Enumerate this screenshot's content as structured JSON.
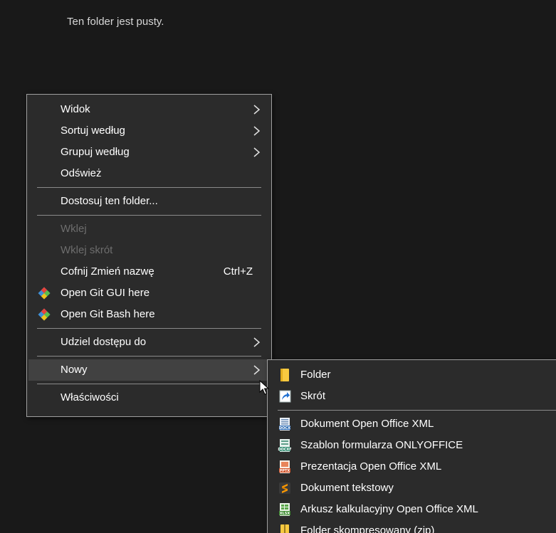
{
  "explorer": {
    "empty_message": "Ten folder jest pusty."
  },
  "context_menu": {
    "items": [
      {
        "label": "Widok"
      },
      {
        "label": "Sortuj według"
      },
      {
        "label": "Grupuj według"
      },
      {
        "label": "Odśwież"
      },
      {
        "label": "Dostosuj ten folder..."
      },
      {
        "label": "Wklej"
      },
      {
        "label": "Wklej skrót"
      },
      {
        "label": "Cofnij Zmień nazwę",
        "shortcut": "Ctrl+Z"
      },
      {
        "label": "Open Git GUI here"
      },
      {
        "label": "Open Git Bash here"
      },
      {
        "label": "Udziel dostępu do"
      },
      {
        "label": "Nowy"
      },
      {
        "label": "Właściwości"
      }
    ]
  },
  "new_submenu": {
    "items": [
      {
        "label": "Folder"
      },
      {
        "label": "Skrót"
      },
      {
        "label": "Dokument Open Office XML"
      },
      {
        "label": "Szablon formularza ONLYOFFICE"
      },
      {
        "label": "Prezentacja Open Office XML"
      },
      {
        "label": "Dokument tekstowy"
      },
      {
        "label": "Arkusz kalkulacyjny Open Office XML"
      },
      {
        "label": "Folder skompresowany (zip)"
      }
    ]
  },
  "colors": {
    "background": "#191919",
    "menu_bg": "#2b2b2b",
    "hover_bg": "#414141",
    "disabled_text": "#6d6d6d"
  }
}
